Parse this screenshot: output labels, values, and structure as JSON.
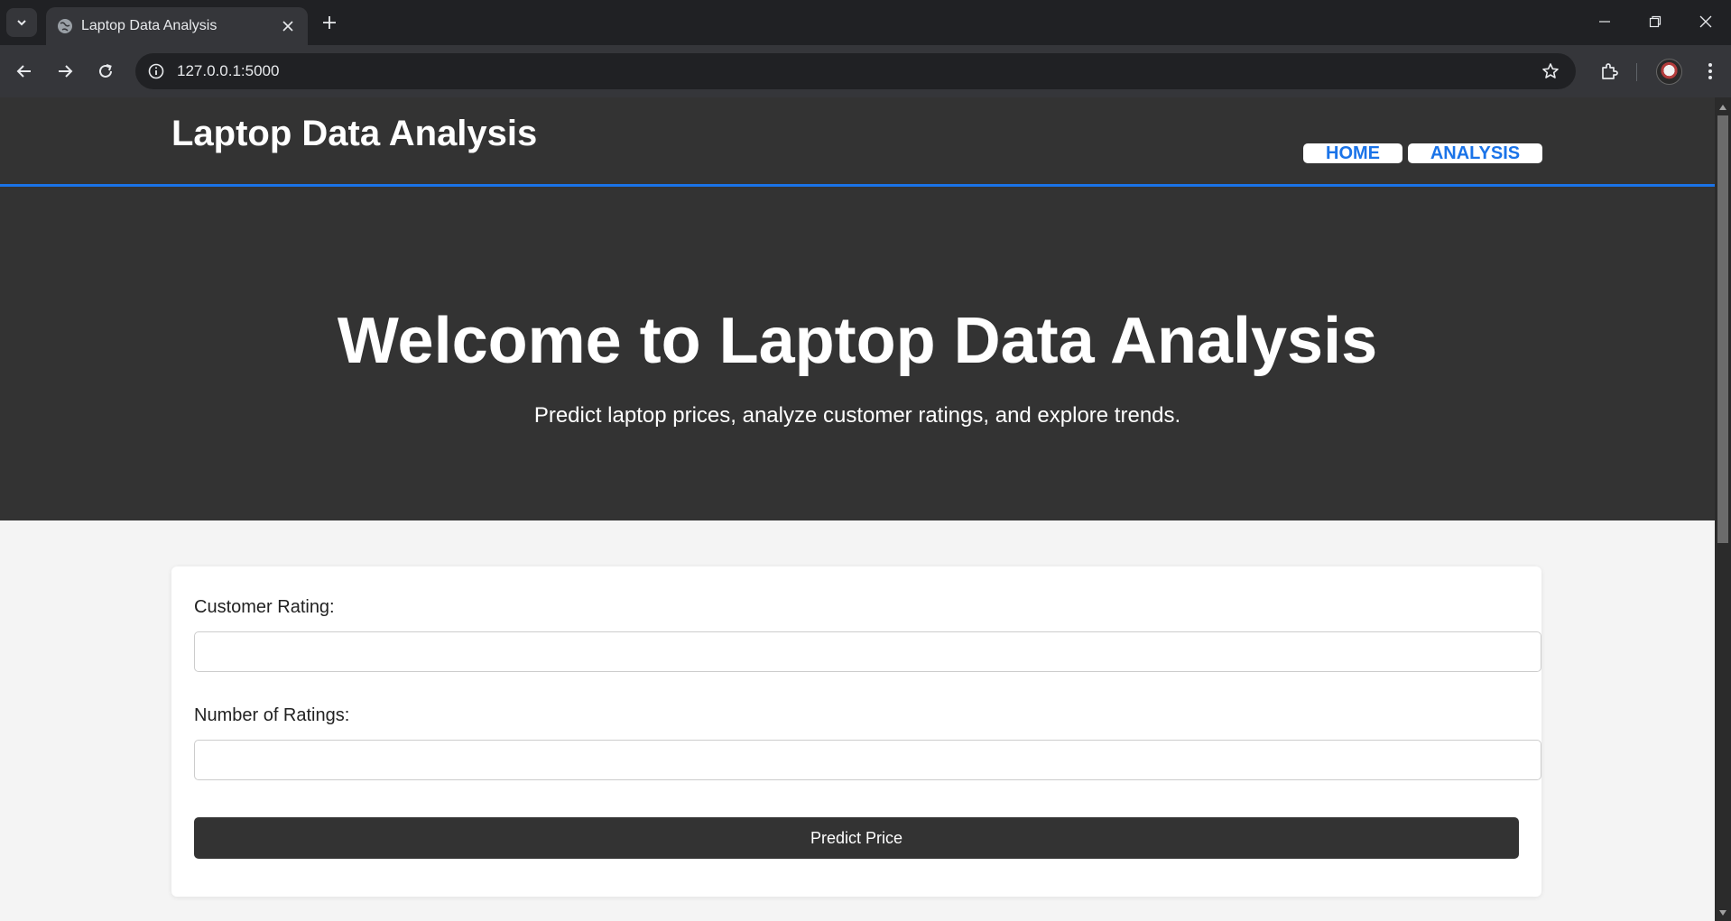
{
  "browser": {
    "tab_title": "Laptop Data Analysis",
    "url": "127.0.0.1:5000",
    "icons": {
      "tab_search": "chevron-down-icon",
      "favicon": "globe-icon",
      "tab_close": "close-icon",
      "new_tab": "plus-icon",
      "back": "arrow-left-icon",
      "forward": "arrow-right-icon",
      "reload": "reload-icon",
      "site_info": "info-icon",
      "bookmark": "star-icon",
      "extensions": "puzzle-icon",
      "menu": "kebab-menu-icon"
    }
  },
  "site": {
    "logo": "Laptop Data Analysis",
    "nav": [
      {
        "label": "HOME"
      },
      {
        "label": "ANALYSIS"
      }
    ],
    "accent_color": "#1a73e8"
  },
  "hero": {
    "title": "Welcome to Laptop Data Analysis",
    "subtitle": "Predict laptop prices, analyze customer ratings, and explore trends."
  },
  "form": {
    "rating_label": "Customer Rating:",
    "rating_value": "",
    "num_ratings_label": "Number of Ratings:",
    "num_ratings_value": "",
    "submit_label": "Predict Price"
  }
}
